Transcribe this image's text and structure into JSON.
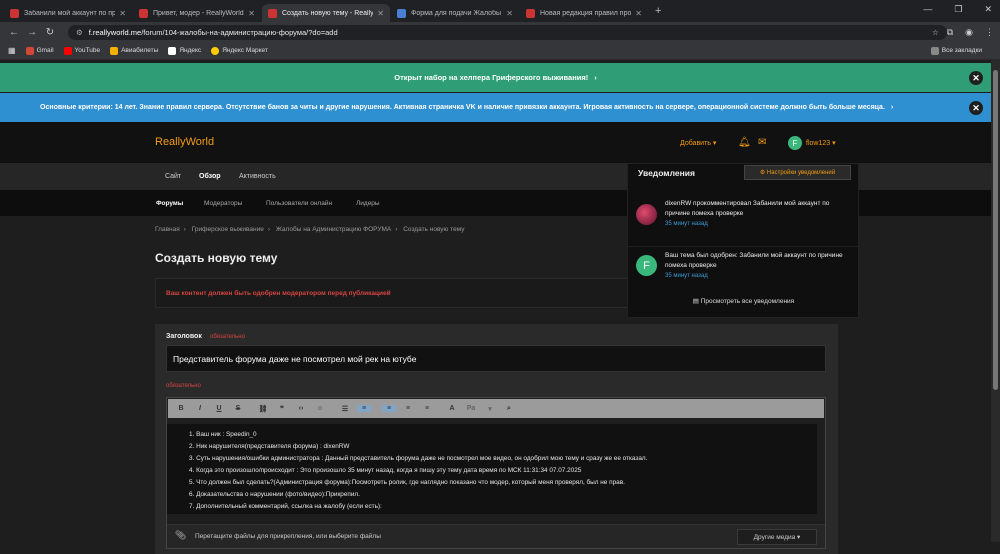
{
  "browser": {
    "tabs": [
      {
        "label": "Забанили мой аккаунт по при",
        "active": false
      },
      {
        "label": "Привет, модер - ReallyWorld",
        "active": false
      },
      {
        "label": "Создать новую тему - ReallyW",
        "active": true
      },
      {
        "label": "Форма для подачи Жалобы на",
        "active": false
      },
      {
        "label": "Новая редакция правил проек",
        "active": false
      }
    ],
    "url_host": "f.reallyworld.me",
    "url_path": "/forum/104-жалобы-на-администрацию-форума/?do=add",
    "bookmarks": [
      "Gmail",
      "YouTube",
      "Авиабилеты",
      "Яндекс",
      "Яндекс Маркет"
    ],
    "bookmarks_all": "Все закладки"
  },
  "notices": {
    "notice1": "Открыт набор на хелпера Гриферского выживания!",
    "notice2": "Основные критерии: 14 лет. Знание правил сервера. Отсутствие банов за читы и другие нарушения. Активная страничка VK и наличие привязки аккаунта. Игровая активность на сервере, операционной системе должно быть больше месяца."
  },
  "header": {
    "logo": "ReallyWorld",
    "add_label": "Добавить ▾",
    "avatar_letter": "F",
    "username": "flow123 ▾"
  },
  "nav": {
    "primary": [
      "Сайт",
      "Обзор",
      "Активность"
    ],
    "secondary": [
      "Форумы",
      "Модераторы",
      "Пользователи онлайн",
      "Лидеры"
    ]
  },
  "breadcrumb": [
    "Главная",
    "›",
    "Гриферское выживание",
    "›",
    "Жалобы на Администрацию ФОРУМА",
    "›",
    "Создать новую тему"
  ],
  "page_title": "Создать новую тему",
  "mod_notice": "Ваш контент должен быть одобрен модератором перед публикацией",
  "form": {
    "title_label": "Заголовок",
    "required": "обязательно",
    "title_value": "Представитель форума даже не посмотрел мой рек на ютубе",
    "body_lines": [
      "1. Ваш ник : Speedin_0",
      "2. Ник нарушителя(представителя форума) : dixenRW",
      "3. Суть нарушения/ошибки администратора : Данный представитель форума даже не посмотрел мое видео, он одобрил мою тему и сразу же ее отказал.",
      "4. Когда это произошло/происходит : Это произошло 35 минут назад, когда я пишу эту тему дата время по МСК 11:31:34 07.07.2025",
      "5. Что должен был сделать?(Администрация форума):Посмотреть ролик, где наглядно показано что модер, который меня проверял, был не прав.",
      "6. Доказательства о нарушении (фото/видео):Прикрепил.",
      "7. Дополнительный комментарий, ссылка на жалобу (если есть):"
    ],
    "attach_text": "Перетащите файлы для прикрепления, или выберите файлы",
    "more_options": "Другие медиа ▾"
  },
  "notifications": {
    "title": "Уведомления",
    "settings": "⚙ Настройки уведомлений",
    "items": [
      {
        "text": "dixenRW прокомментировал Забанили мой аккаунт по причине помеха проверке",
        "time": "35 минут назад"
      },
      {
        "text": "Ваш тема был одобрен: Забанили мой аккаунт по причине помеха проверке",
        "time": "35 минут назад"
      }
    ],
    "view_all": "Просмотреть все уведомления",
    "avatar_letter": "F"
  },
  "colors": {
    "accent": "#f39c12",
    "notice_green": "#2f9e76",
    "notice_blue": "#2e8fd1",
    "danger": "#d64541"
  }
}
